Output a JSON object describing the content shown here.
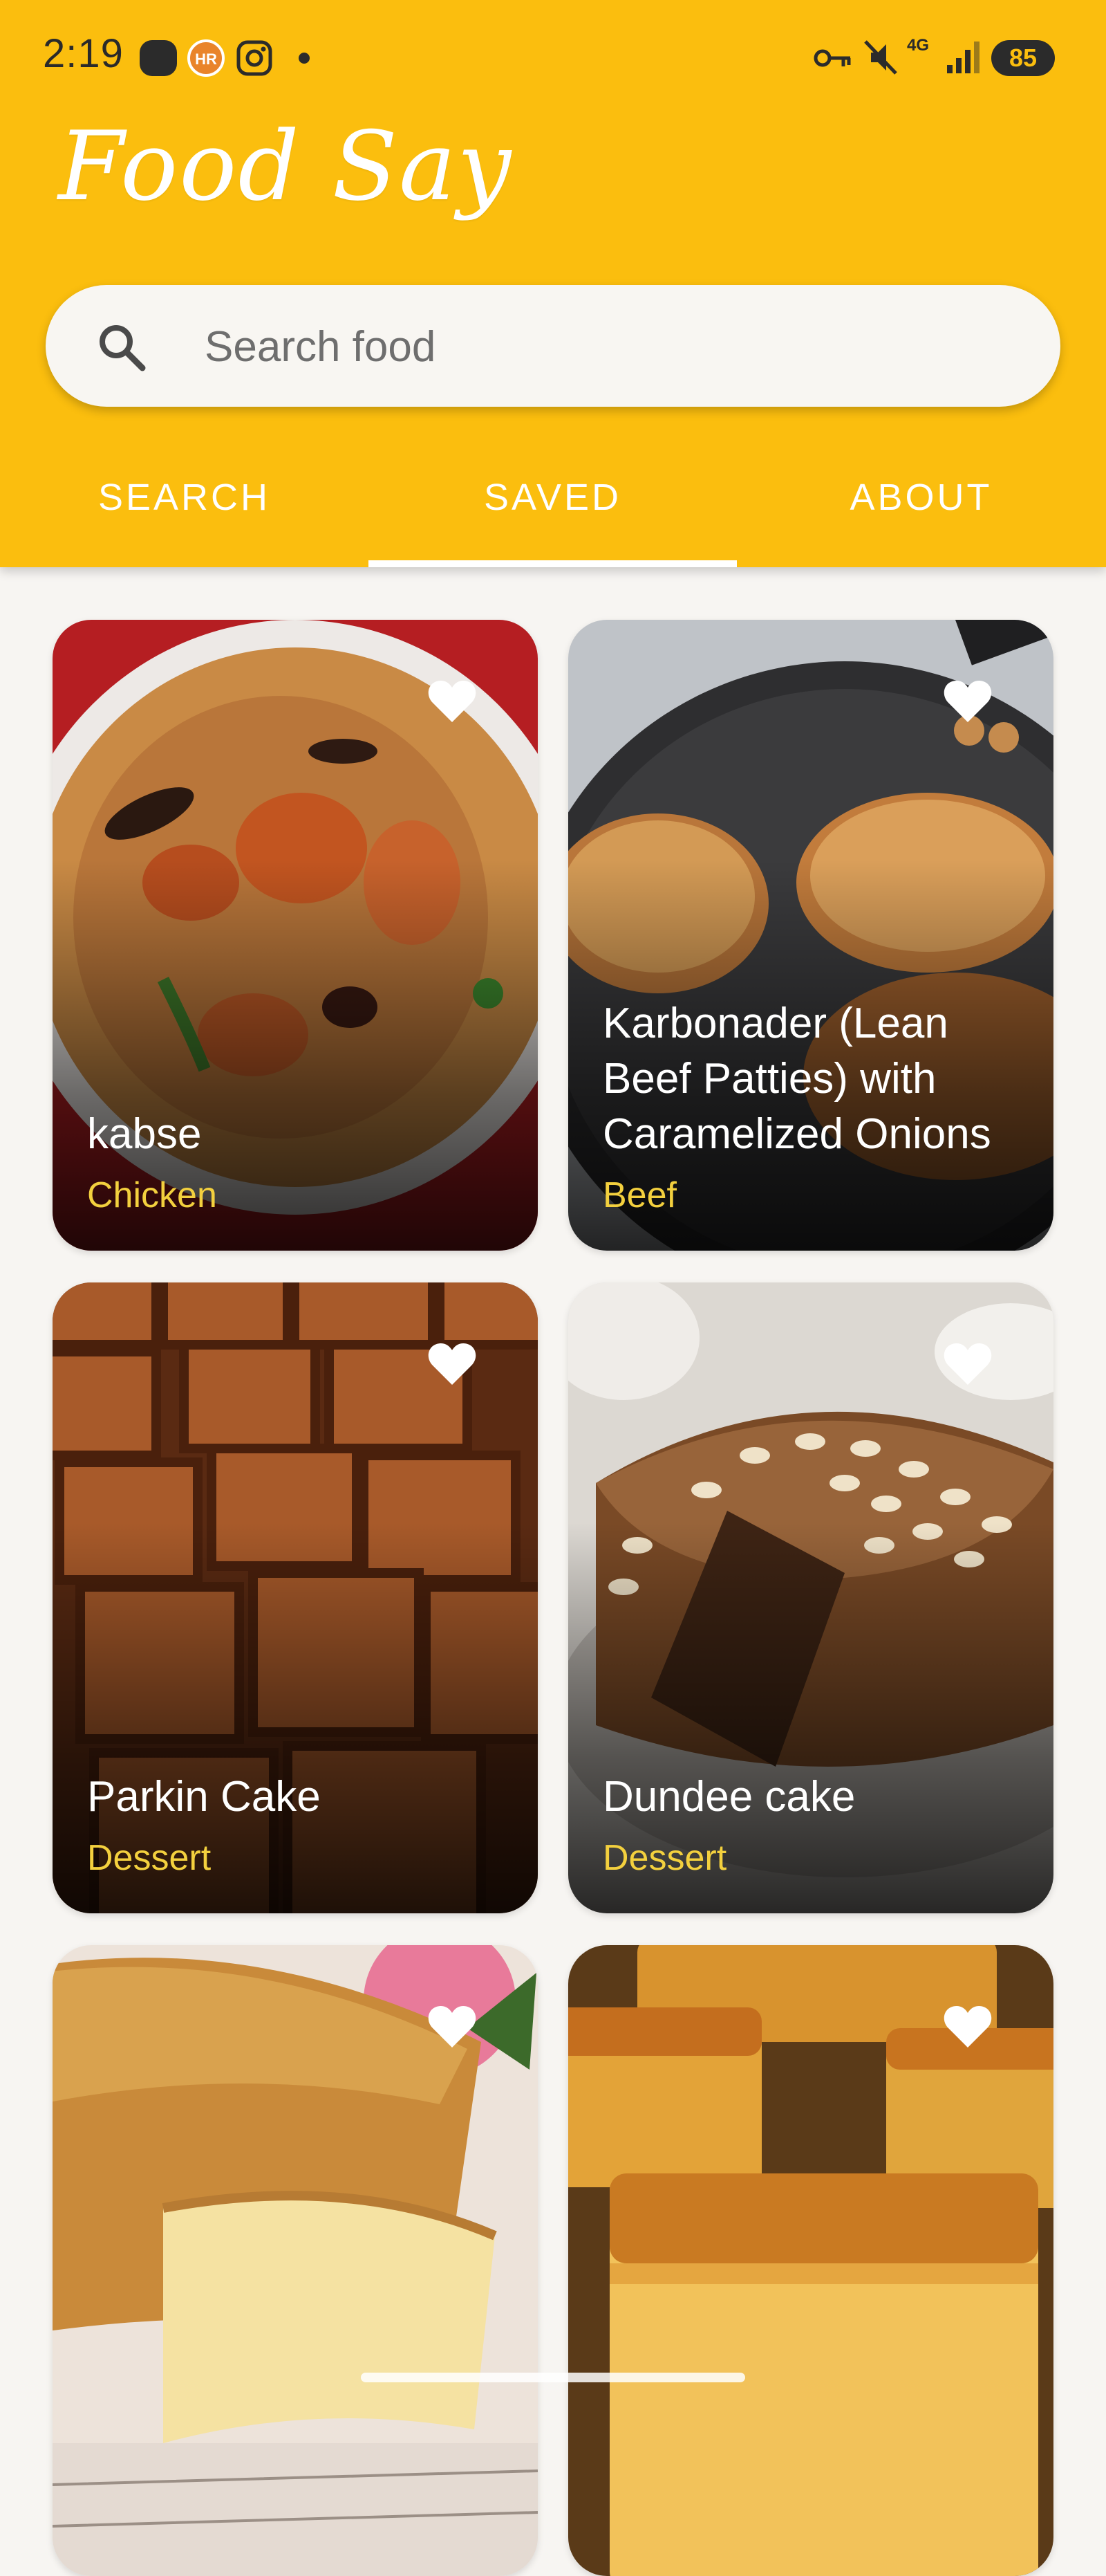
{
  "status_bar": {
    "time": "2:19",
    "battery": "85",
    "network": "4G",
    "left_icons": [
      "app-icon",
      "hr-badge-icon",
      "instagram-icon",
      "notification-dot-icon"
    ],
    "right_icons": [
      "vpn-key-icon",
      "mute-icon",
      "signal-icon",
      "battery-icon"
    ]
  },
  "app": {
    "title": "Food Say",
    "accent_color": "#FBBE0E",
    "category_color": "#F3D03E"
  },
  "search": {
    "placeholder": "Search food",
    "value": ""
  },
  "tabs": [
    {
      "label": "SEARCH",
      "active": false
    },
    {
      "label": "SAVED",
      "active": true
    },
    {
      "label": "ABOUT",
      "active": false
    }
  ],
  "meals": [
    {
      "name": "kabse",
      "category": "Chicken",
      "saved": true
    },
    {
      "name": "Karbonader (Lean Beef Patties) with Caramelized Onions",
      "category": "Beef",
      "saved": true
    },
    {
      "name": "Parkin Cake",
      "category": "Dessert",
      "saved": true
    },
    {
      "name": "Dundee cake",
      "category": "Dessert",
      "saved": true
    },
    {
      "name": "",
      "category": "",
      "saved": true
    },
    {
      "name": "",
      "category": "",
      "saved": true
    }
  ]
}
